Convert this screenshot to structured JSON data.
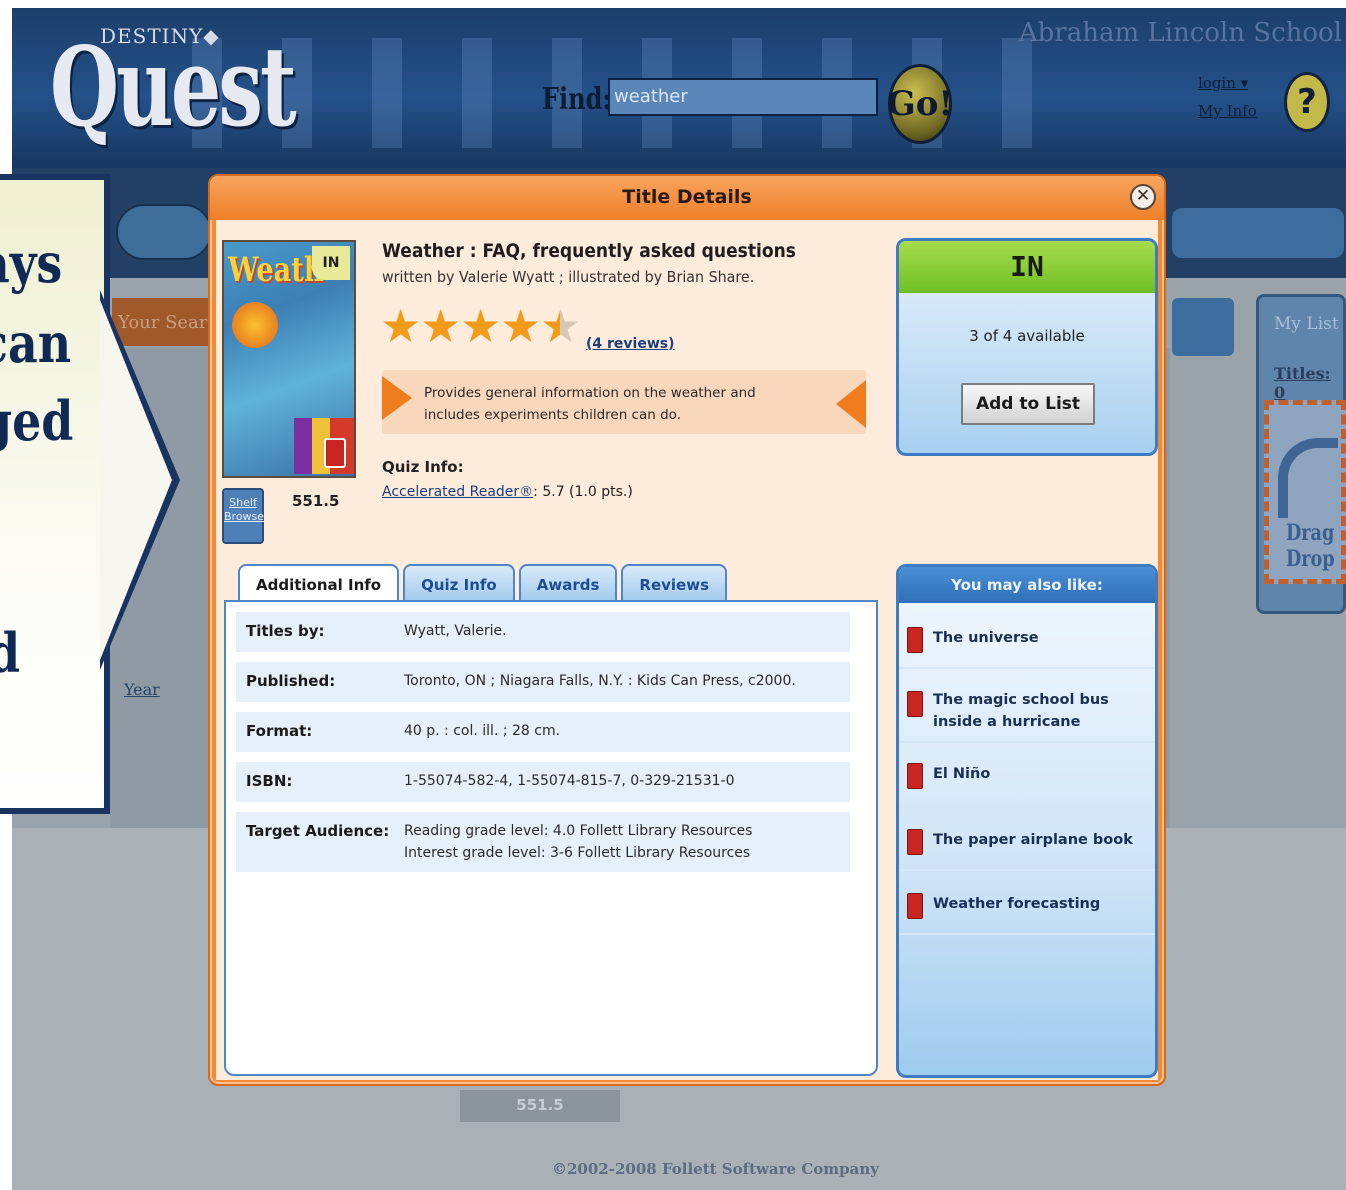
{
  "app": {
    "brand_small": "DESTINY◆",
    "brand_big": "Quest",
    "school_name": "Abraham Lincoln School",
    "find_label": "Find:",
    "find_value": "weather",
    "go_label": "Go!",
    "login_label": "login ▾",
    "myinfo_label": "My Info",
    "help_label": "?",
    "your_search_label": "Your Searc",
    "year_label": "Year",
    "my_list_title": "My List",
    "my_list_titles": "Titles: 0",
    "drag_drop_label": "Drag Drop",
    "bg_call_number": "551.5",
    "copyright": "©2002-2008 Follett Software Company"
  },
  "callout": {
    "lines": [
      "ays",
      "can",
      "ged",
      "",
      "",
      "d"
    ]
  },
  "modal": {
    "title": "Title Details",
    "close_label": "✕",
    "cover": {
      "title_text": "Weath",
      "badge": "IN"
    },
    "shelf_browse_label": "Shelf Browse",
    "call_number": "551.5",
    "book_title": "Weather : FAQ, frequently asked questions",
    "book_author": "written by Valerie Wyatt ; illustrated by Brian Share.",
    "rating": 4.5,
    "reviews_link": "(4 reviews)",
    "summary": "Provides general information on the weather and includes experiments children can do.",
    "quiz_info_label": "Quiz Info:",
    "quiz_info_program": "Accelerated Reader®",
    "quiz_info_value": ": 5.7 (1.0 pts.)",
    "status": {
      "label": "IN",
      "availability": "3 of 4 available",
      "add_to_list_label": "Add to List"
    },
    "tabs": [
      {
        "label": "Additional Info",
        "active": true
      },
      {
        "label": "Quiz Info",
        "active": false
      },
      {
        "label": "Awards",
        "active": false
      },
      {
        "label": "Reviews",
        "active": false
      }
    ],
    "info_rows": [
      {
        "label": "Titles by:",
        "value": "Wyatt, Valerie."
      },
      {
        "label": "Published:",
        "value": "Toronto, ON ; Niagara Falls, N.Y. : Kids Can Press, c2000."
      },
      {
        "label": "Format:",
        "value": "40 p. : col. ill. ; 28 cm."
      },
      {
        "label": "ISBN:",
        "value": "1-55074-582-4, 1-55074-815-7, 0-329-21531-0"
      },
      {
        "label": "Target Audience:",
        "value": "Reading grade level: 4.0 Follett Library Resources",
        "value2": "Interest grade level: 3-6 Follett Library Resources"
      }
    ],
    "also_like": {
      "header": "You may also like:",
      "items": [
        "The universe",
        "The magic school bus inside a hurricane",
        "El Niño",
        "The paper airplane book",
        "Weather forecasting"
      ]
    }
  }
}
